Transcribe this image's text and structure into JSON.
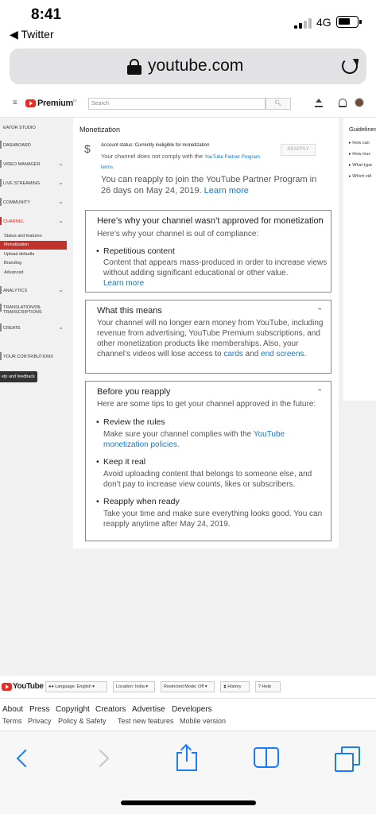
{
  "status_bar": {
    "time": "8:41",
    "back_app": "◀ Twitter",
    "network": "4G"
  },
  "safari": {
    "url": "youtube.com"
  },
  "yt_header": {
    "logo": "Premium",
    "logo_sup": "IN",
    "search_placeholder": "Search"
  },
  "sidebar": {
    "title": "EATOR STUDIO",
    "items": [
      {
        "label": "DASHBOARD"
      },
      {
        "label": "VIDEO MANAGER"
      },
      {
        "label": "LIVE STREAMING"
      },
      {
        "label": "COMMUNITY"
      },
      {
        "label": "CHANNEL"
      },
      {
        "label": "ANALYTICS"
      },
      {
        "label": "TRANSLATIONS & TRANSCRIPTIONS"
      },
      {
        "label": "CREATE"
      },
      {
        "label": "YOUR CONTRIBUTIONS"
      }
    ],
    "channel_subitems": [
      "Status and features",
      "Monetization",
      "Upload defaults",
      "Branding",
      "Advanced"
    ],
    "help": "elp and feedback"
  },
  "monetization": {
    "title": "Monetization",
    "account_status": "Account status: Currently ineligible for monetization",
    "desc_prefix": "Your channel does not comply with the ",
    "desc_link": "YouTube Partner Program terms",
    "desc_suffix": ".",
    "reapply_button": "REAPPLY",
    "reapply_text": "You can reapply to join the YouTube Partner Program in 26 days on May 24, 2019.",
    "learn_more": "Learn more"
  },
  "card_not_approved": {
    "title": "Here’s why your channel wasn’t approved for monetization",
    "subtitle": "Here’s why your channel is out of compliance:",
    "bullet_title": "Repetitious content",
    "bullet_body": "Content that appears mass-produced in order to increase views without adding significant educational or other value.",
    "learn_more": "Learn more"
  },
  "card_means": {
    "title": "What this means",
    "body": "Your channel will no longer earn money from YouTube, including revenue from advertising, YouTube Premium subscriptions, and other monetization products like memberships. Also, your channel’s videos will lose access to",
    "link1": "cards",
    "and": "and",
    "link2": "end screens",
    "end": "."
  },
  "card_before": {
    "title": "Before you reapply",
    "subtitle": "Here are some tips to get your channel approved in the future:",
    "tips": [
      {
        "title": "Review the rules",
        "body": "Make sure your channel complies with the ",
        "link": "YouTube monetization policies",
        "end": "."
      },
      {
        "title": "Keep it real",
        "body": "Avoid uploading content that belongs to someone else, and don’t pay to increase view counts, likes or subscribers."
      },
      {
        "title": "Reapply when ready",
        "body": "Take your time and make sure everything looks good. You can reapply anytime after May 24, 2019."
      }
    ]
  },
  "guidelines": {
    "title": "Guidelines",
    "items": [
      "How can",
      "How muc",
      "What type",
      "Which vid"
    ]
  },
  "footer": {
    "logo": "YouTube",
    "buttons": [
      "Language: English",
      "Location: India",
      "Restricted Mode: Off",
      "History",
      "Help"
    ],
    "links": [
      "About",
      "Press",
      "Copyright",
      "Creators",
      "Advertise",
      "Developers"
    ],
    "links2": [
      "Terms",
      "Privacy",
      "Policy & Safety",
      "Test new features",
      "Mobile version"
    ]
  },
  "colors": {
    "accent": "#c0322b",
    "link": "#167ac6",
    "ios_blue": "#1a7cf6"
  }
}
